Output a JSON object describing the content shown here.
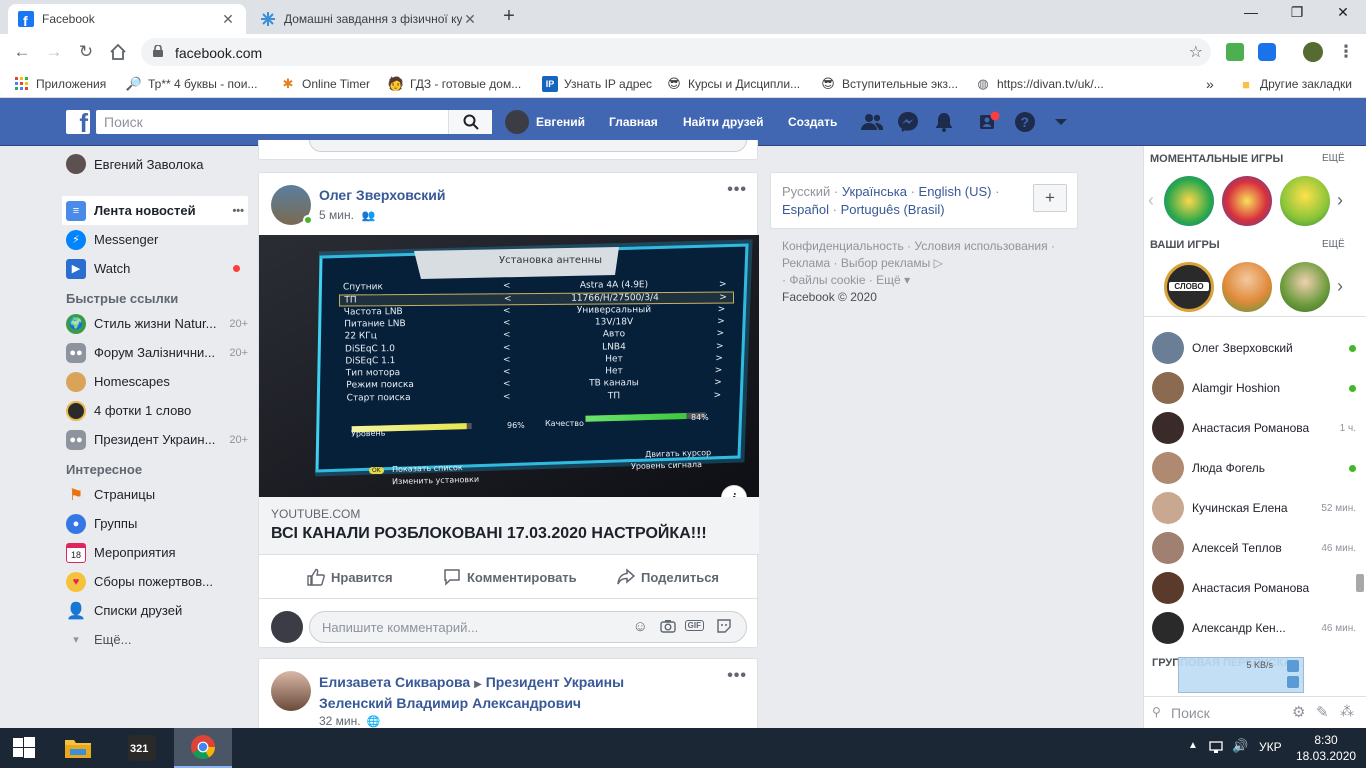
{
  "browser": {
    "tabs": [
      {
        "title": "Facebook",
        "close": "✕"
      },
      {
        "title": "Домашні завдання з фізичної ку",
        "close": "✕"
      }
    ],
    "new_tab": "+",
    "window_controls": {
      "minimize": "—",
      "maximize": "❐",
      "close": "✕"
    },
    "url": "facebook.com",
    "bookmarks": [
      {
        "label": "Приложения"
      },
      {
        "label": "Тр** 4 буквы - пои..."
      },
      {
        "label": "Online Timer"
      },
      {
        "label": "ГДЗ - готовые дом..."
      },
      {
        "label": "Узнать IP адрес"
      },
      {
        "label": "Курсы и Дисципли..."
      },
      {
        "label": "Вступительные экз..."
      },
      {
        "label": "https://divan.tv/uk/..."
      }
    ],
    "bookmarks_more": "»",
    "other_bookmarks": "Другие закладки"
  },
  "fb_header": {
    "search_placeholder": "Поиск",
    "user_name": "Евгений",
    "home": "Главная",
    "find_friends": "Найти друзей",
    "create": "Создать"
  },
  "left_nav": {
    "profile": "Евгений Заволока",
    "main": [
      {
        "label": "Лента новостей",
        "more": "•••"
      },
      {
        "label": "Messenger"
      },
      {
        "label": "Watch"
      }
    ],
    "shortcuts_title": "Быстрые ссылки",
    "shortcuts": [
      {
        "label": "Стиль жизни Natur...",
        "count": "20+"
      },
      {
        "label": "Форум Залізнични...",
        "count": "20+"
      },
      {
        "label": "Homescapes",
        "count": ""
      },
      {
        "label": "4 фотки 1 слово",
        "count": ""
      },
      {
        "label": "Президент Украин...",
        "count": "20+"
      }
    ],
    "explore_title": "Интересное",
    "explore": [
      {
        "label": "Страницы"
      },
      {
        "label": "Группы"
      },
      {
        "label": "Мероприятия"
      },
      {
        "label": "Сборы пожертвов..."
      },
      {
        "label": "Списки друзей"
      }
    ],
    "more": "Ещё..."
  },
  "post1": {
    "author": "Олег Зверховский",
    "time": "5 мин.",
    "more": "•••",
    "video": {
      "screen_title": "Установка антенны",
      "rows": [
        {
          "label": "Спутник",
          "value": "Astra 4A (4.9E)"
        },
        {
          "label": "ТП",
          "value": "11766/H/27500/3/4"
        },
        {
          "label": "Частота LNB",
          "value": "Универсальный"
        },
        {
          "label": "Питание LNB",
          "value": "13V/18V"
        },
        {
          "label": "22 КГц",
          "value": "Авто"
        },
        {
          "label": "DiSEqC 1.0",
          "value": "LNB4"
        },
        {
          "label": "DiSEqC 1.1",
          "value": "Нет"
        },
        {
          "label": "Тип мотора",
          "value": "Нет"
        },
        {
          "label": "Режим поиска",
          "value": "ТВ каналы"
        },
        {
          "label": "Старт поиска",
          "value": "ТП"
        }
      ],
      "level_label": "Уровень",
      "level_value": "96%",
      "level_fraction": 0.96,
      "quality_label": "Качество",
      "quality_value": "84%",
      "quality_fraction": 0.84,
      "hint1": "Показать список",
      "hint2": "Изменить установки",
      "hint3": "Двигать курсор",
      "hint4": "Уровень сигнала",
      "ok": "OK"
    },
    "source": "YOUTUBE.COM",
    "link_title": "ВСІ КАНАЛИ РОЗБЛОКОВАНІ 17.03.2020 НАСТРОЙКА!!!",
    "like": "Нравится",
    "comment": "Комментировать",
    "share": "Поделиться",
    "comment_placeholder": "Напишите комментарий..."
  },
  "post2": {
    "author": "Елизавета Сикварова",
    "arrow": "▶",
    "target": "Президент Украины Зеленский Владимир Александрович",
    "time": "32 мин.",
    "more": "•••"
  },
  "lang": {
    "items": [
      "Русский",
      "Українська",
      "English (US)",
      "Español",
      "Português (Brasil)"
    ],
    "sep": "·",
    "add": "+"
  },
  "footer": {
    "links": [
      "Конфиденциальность",
      "Условия использования",
      "Реклама",
      "Выбор рекламы",
      "Файлы cookie",
      "Ещё"
    ],
    "copyright": "Facebook © 2020"
  },
  "right": {
    "instant_games": "МОМЕНТАЛЬНЫЕ ИГРЫ",
    "your_games": "ВАШИ ИГРЫ",
    "more": "ЕЩЁ",
    "slovo": "СЛОВО",
    "contacts": [
      {
        "name": "Олег Зверховский",
        "status": "",
        "online": true
      },
      {
        "name": "Alamgir Hoshion",
        "status": "",
        "online": true
      },
      {
        "name": "Анастасия Романова",
        "status": "1 ч.",
        "online": false
      },
      {
        "name": "Люда Фогель",
        "status": "",
        "online": true
      },
      {
        "name": "Кучинская Елена",
        "status": "52 мин.",
        "online": false
      },
      {
        "name": "Алексей Теплов",
        "status": "46 мин.",
        "online": false
      },
      {
        "name": "Анастасия Романова",
        "status": "",
        "online": false
      },
      {
        "name": "Александр Кен...",
        "status": "46 мин.",
        "online": false
      }
    ],
    "group_chats": "ГРУППОВАЯ ПЕРЕПИСКА",
    "search_placeholder": "Поиск",
    "net_speed": "5 KB/s"
  },
  "taskbar": {
    "app_badge": "321",
    "lang": "УКР",
    "time": "8:30",
    "date": "18.03.2020"
  }
}
